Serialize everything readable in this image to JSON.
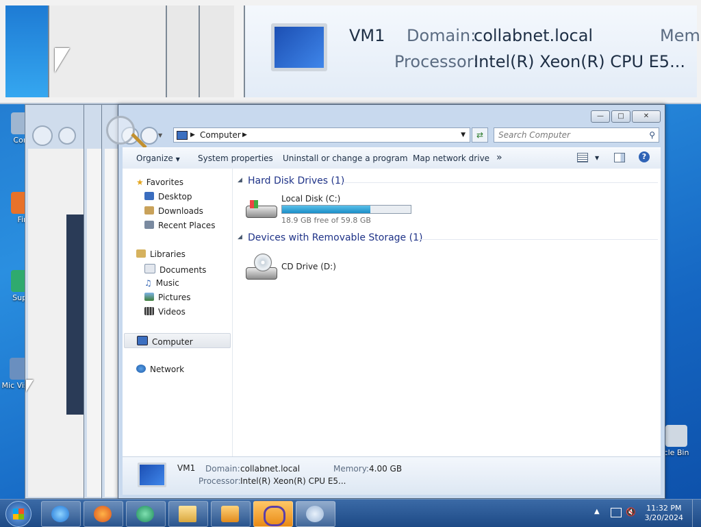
{
  "zoom": {
    "vm_name": "VM1",
    "domain_label": "Domain:",
    "domain_value": "collabnet.local",
    "memory_label_partial": "Mem",
    "processor_label": "Processor:",
    "processor_value": "Intel(R) Xeon(R) CPU E5..."
  },
  "desktop_icons": [
    {
      "label": "Com"
    },
    {
      "label": "Fir"
    },
    {
      "label": "Supe"
    },
    {
      "label": "Mic Visual"
    },
    {
      "label": "cle Bin"
    }
  ],
  "window": {
    "breadcrumb": [
      "Computer"
    ],
    "search_placeholder": "Search Computer",
    "toolbar": {
      "organize": "Organize",
      "system_properties": "System properties",
      "uninstall": "Uninstall or change a program",
      "map_drive": "Map network drive",
      "more": "»"
    },
    "nav": {
      "favorites": "Favorites",
      "desktop": "Desktop",
      "downloads": "Downloads",
      "recent": "Recent Places",
      "libraries": "Libraries",
      "documents": "Documents",
      "music": "Music",
      "pictures": "Pictures",
      "videos": "Videos",
      "computer": "Computer",
      "network": "Network"
    },
    "groups": {
      "hdd": "Hard Disk Drives (1)",
      "removable": "Devices with Removable Storage (1)"
    },
    "drives": {
      "local_name": "Local Disk (C:)",
      "local_free": "18.9 GB free of 59.8 GB",
      "local_used_fraction": 0.684,
      "cd_name": "CD Drive (D:)"
    },
    "details": {
      "vm_name": "VM1",
      "domain_label": "Domain:",
      "domain_value": "collabnet.local",
      "memory_label": "Memory:",
      "memory_value": "4.00 GB",
      "processor_label": "Processor:",
      "processor_value": "Intel(R) Xeon(R) CPU E5..."
    }
  },
  "taskbar": {
    "time": "11:32 PM",
    "date": "3/20/2024"
  }
}
